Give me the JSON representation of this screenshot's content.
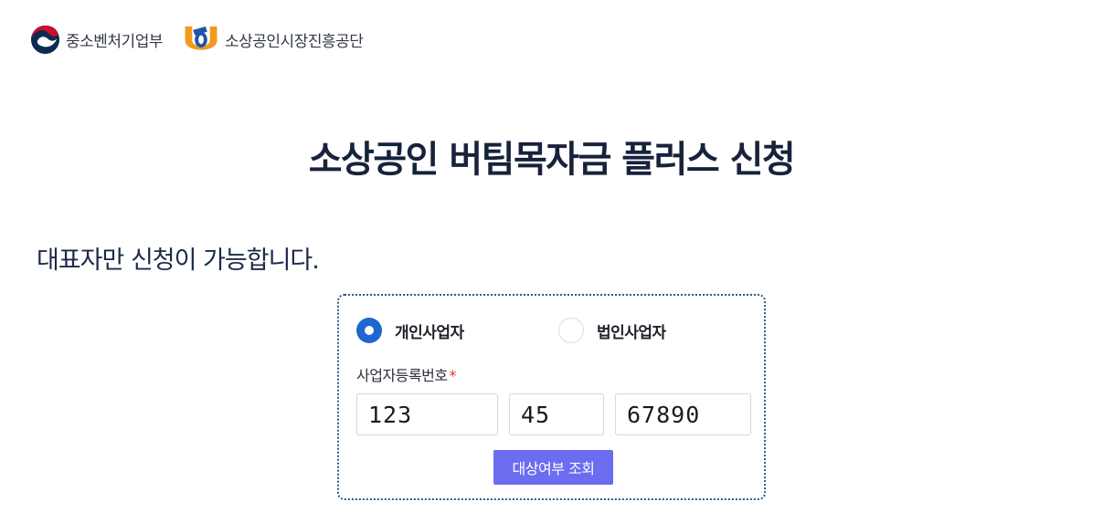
{
  "header": {
    "logo1_text": "중소벤처기업부",
    "logo2_text": "소상공인시장진흥공단"
  },
  "page": {
    "title": "소상공인 버팀목자금 플러스 신청",
    "notice": "대표자만 신청이 가능합니다."
  },
  "form": {
    "radio_individual_label": "개인사업자",
    "radio_corporate_label": "법인사업자",
    "selected": "개인사업자",
    "biz_number_label": "사업자등록번호",
    "required_mark": "*",
    "biz_number_part1": "123",
    "biz_number_part2": "45",
    "biz_number_part3": "67890",
    "check_button_label": "대상여부 조회"
  },
  "colors": {
    "primary_blue": "#1e66d0",
    "button_purple": "#6b6cf0",
    "title_navy": "#17223b",
    "required_red": "#e3342f",
    "card_border": "#2f5b86"
  }
}
